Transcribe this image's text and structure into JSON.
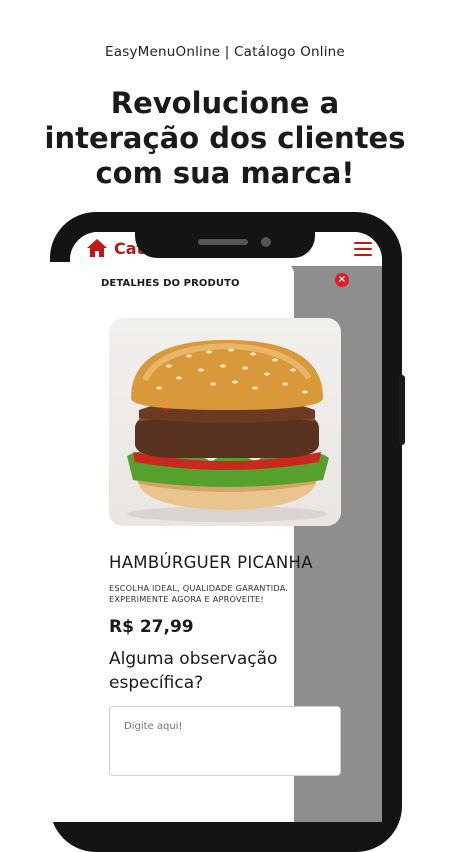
{
  "header": {
    "subtitle": "EasyMenuOnline | Catálogo Online",
    "headline_lines": [
      "Revolucione a",
      "interação dos clientes",
      "com sua marca!"
    ]
  },
  "app_bar": {
    "title": "Cat",
    "accent_color": "#b01c1c"
  },
  "modal": {
    "title": "DETALHES DO PRODUTO",
    "close_label": "×",
    "product": {
      "image": "hamburger-photo",
      "name": "HAMBÚRGUER PICANHA",
      "description": "ESCOLHA IDEAL, QUALIDADE GARANTIDA. EXPERIMENTE AGORA E APROVEITE!",
      "price": "R$ 27,99"
    },
    "observation": {
      "label": "Alguma observação específica?",
      "placeholder": "Digite aqui!"
    }
  }
}
